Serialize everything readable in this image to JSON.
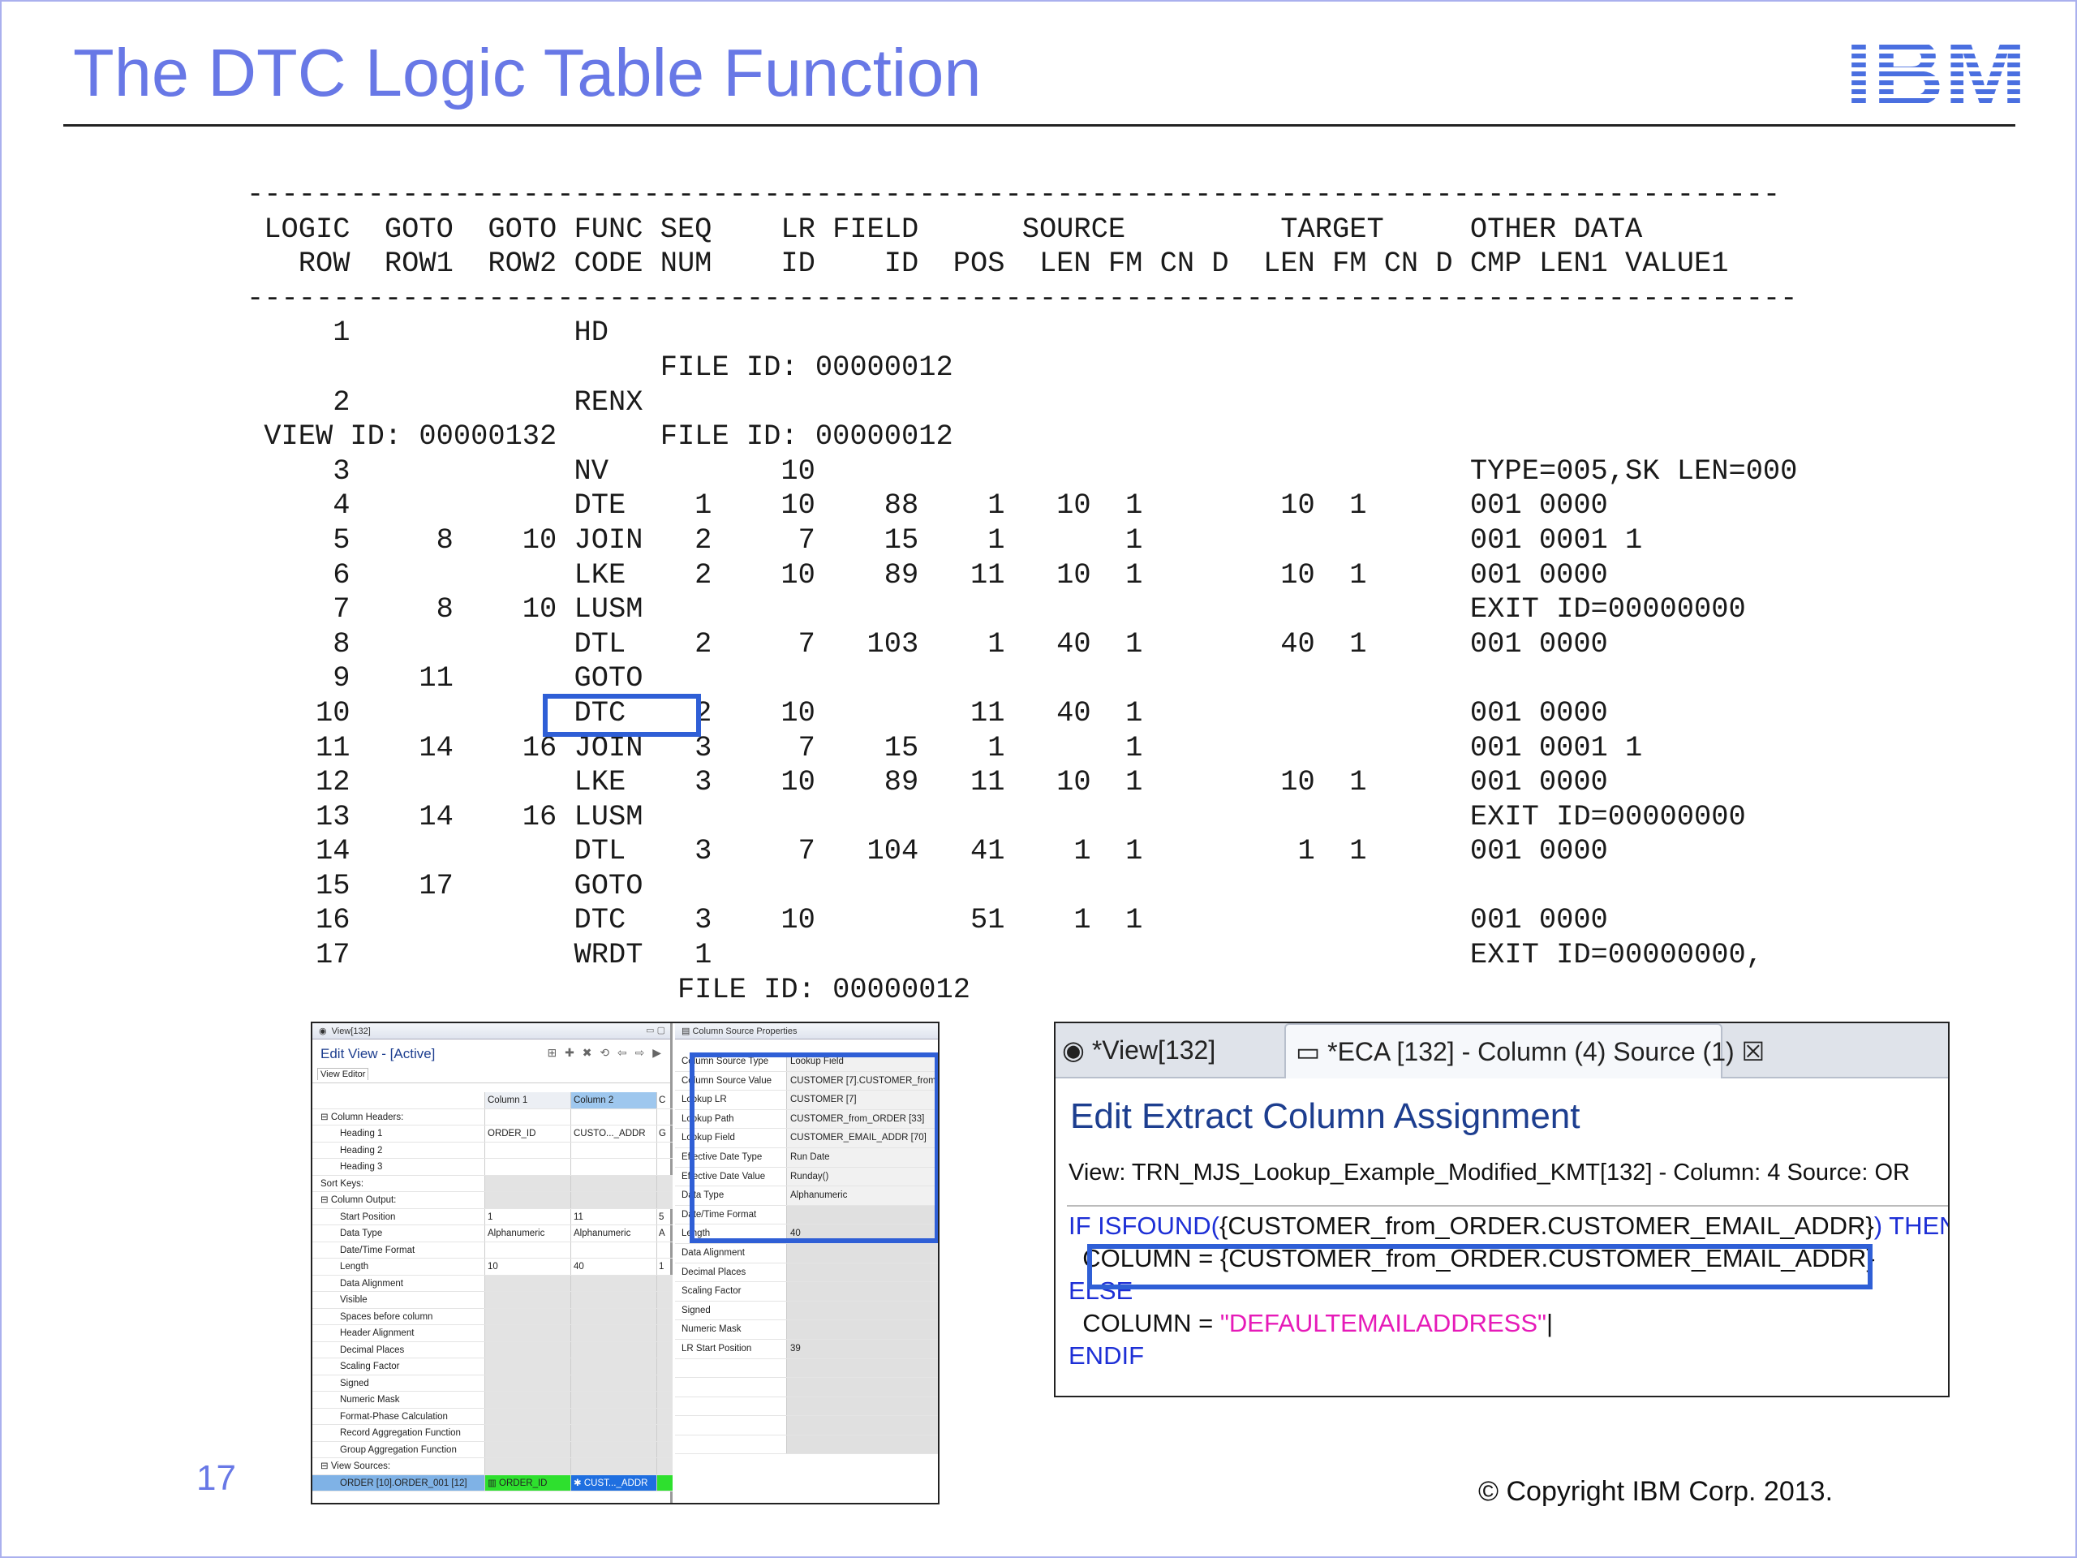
{
  "slide": {
    "title": "The DTC Logic Table Function",
    "logo_text": "IBM",
    "page_number": "17",
    "copyright": "© Copyright IBM Corp. 2013."
  },
  "logic_table": {
    "lines": [
      "-----------------------------------------------------------------------------------------",
      " LOGIC  GOTO  GOTO FUNC SEQ    LR FIELD      SOURCE         TARGET     OTHER DATA",
      "   ROW  ROW1  ROW2 CODE NUM    ID    ID  POS  LEN FM CN D  LEN FM CN D CMP LEN1 VALUE1",
      "------------------------------------------------------------------------------------------",
      "     1             HD",
      "                        FILE ID: 00000012",
      "     2             RENX",
      " VIEW ID: 00000132      FILE ID: 00000012",
      "     3             NV          10                                      TYPE=005,SK LEN=000",
      "     4             DTE    1    10    88    1   10  1        10  1      001 0000",
      "     5     8    10 JOIN   2     7    15    1       1                   001 0001 1",
      "     6             LKE    2    10    89   11   10  1        10  1      001 0000",
      "     7     8    10 LUSM                                                EXIT ID=00000000",
      "     8             DTL    2     7   103    1   40  1        40  1      001 0000",
      "     9    11       GOTO",
      "    10             DTC    2    10         11   40  1                   001 0000",
      "    11    14    16 JOIN   3     7    15    1       1                   001 0001 1",
      "    12             LKE    3    10    89   11   10  1        10  1      001 0000",
      "    13    14    16 LUSM                                                EXIT ID=00000000",
      "    14             DTL    3     7   104   41    1  1         1  1      001 0000",
      "    15    17       GOTO",
      "    16             DTC    3    10         51    1  1                   001 0000",
      "    17             WRDT   1                                            EXIT ID=00000000,",
      "                         FILE ID: 00000012"
    ]
  },
  "edit_view": {
    "tab": "View[132]",
    "title": "Edit View - [Active]",
    "tool_icons": "⊞ ✚ ✖ ⟲ ⇦ ⇨ ▶",
    "subtab": "View Editor",
    "rows": [
      {
        "label": "",
        "c1": "Column 1",
        "c2": "Column 2",
        "c3": "C",
        "style": "hdr"
      },
      {
        "label": "⊟  Column Headers:",
        "c1": "",
        "c2": "",
        "c3": "",
        "style": "sec"
      },
      {
        "label": "Heading 1",
        "c1": "ORDER_ID",
        "c2": "CUSTO..._ADDR",
        "c3": "G",
        "style": ""
      },
      {
        "label": "Heading 2",
        "c1": "",
        "c2": "",
        "c3": "",
        "style": ""
      },
      {
        "label": "Heading 3",
        "c1": "",
        "c2": "",
        "c3": "",
        "style": ""
      },
      {
        "label": "Sort Keys:",
        "c1": "",
        "c2": "",
        "c3": "",
        "style": "sec gray"
      },
      {
        "label": "⊟  Column Output:",
        "c1": "",
        "c2": "",
        "c3": "",
        "style": "sec gray"
      },
      {
        "label": "Start Position",
        "c1": "1",
        "c2": "11",
        "c3": "5",
        "style": ""
      },
      {
        "label": "Data Type",
        "c1": "Alphanumeric",
        "c2": "Alphanumeric",
        "c3": "A",
        "style": ""
      },
      {
        "label": "Date/Time Format",
        "c1": "",
        "c2": "",
        "c3": "",
        "style": ""
      },
      {
        "label": "Length",
        "c1": "10",
        "c2": "40",
        "c3": "1",
        "style": ""
      },
      {
        "label": "Data Alignment",
        "c1": "",
        "c2": "",
        "c3": "",
        "style": "gray"
      },
      {
        "label": "Visible",
        "c1": "",
        "c2": "",
        "c3": "",
        "style": "gray"
      },
      {
        "label": "Spaces before column",
        "c1": "",
        "c2": "",
        "c3": "",
        "style": "gray"
      },
      {
        "label": "Header Alignment",
        "c1": "",
        "c2": "",
        "c3": "",
        "style": "gray"
      },
      {
        "label": "Decimal Places",
        "c1": "",
        "c2": "",
        "c3": "",
        "style": "gray"
      },
      {
        "label": "Scaling Factor",
        "c1": "",
        "c2": "",
        "c3": "",
        "style": "gray"
      },
      {
        "label": "Signed",
        "c1": "",
        "c2": "",
        "c3": "",
        "style": "gray"
      },
      {
        "label": "Numeric Mask",
        "c1": "",
        "c2": "",
        "c3": "",
        "style": "gray"
      },
      {
        "label": "Format-Phase Calculation",
        "c1": "",
        "c2": "",
        "c3": "",
        "style": "gray"
      },
      {
        "label": "Record Aggregation Function",
        "c1": "",
        "c2": "",
        "c3": "",
        "style": "gray"
      },
      {
        "label": "Group Aggregation Function",
        "c1": "",
        "c2": "",
        "c3": "",
        "style": "gray"
      },
      {
        "label": "⊟  View Sources:",
        "c1": "",
        "c2": "",
        "c3": "",
        "style": "sec gray"
      },
      {
        "label": "ORDER [10].ORDER_001 [12]",
        "c1": "▥ ORDER_ID",
        "c2": "✱ CUST..._ADDR",
        "c3": "",
        "style": "src"
      }
    ]
  },
  "column_source": {
    "tab": "Column Source Properties",
    "rows": [
      {
        "k": "Column Source Type",
        "v": "Lookup Field"
      },
      {
        "k": "Column Source Value",
        "v": "CUSTOMER [7].CUSTOMER_from"
      },
      {
        "k": "Lookup LR",
        "v": "CUSTOMER [7]"
      },
      {
        "k": "Lookup Path",
        "v": "CUSTOMER_from_ORDER [33]"
      },
      {
        "k": "Lookup Field",
        "v": "CUSTOMER_EMAIL_ADDR [70]"
      },
      {
        "k": "Effective Date Type",
        "v": "Run Date"
      },
      {
        "k": "Effective Date Value",
        "v": "Runday()"
      },
      {
        "k": "Data Type",
        "v": "Alphanumeric"
      },
      {
        "k": "Date/Time Format",
        "v": ""
      },
      {
        "k": "Length",
        "v": "40"
      },
      {
        "k": "Data Alignment",
        "v": ""
      },
      {
        "k": "Decimal Places",
        "v": ""
      },
      {
        "k": "Scaling Factor",
        "v": ""
      },
      {
        "k": "Signed",
        "v": ""
      },
      {
        "k": "Numeric Mask",
        "v": ""
      },
      {
        "k": "LR Start Position",
        "v": "39"
      },
      {
        "k": "",
        "v": ""
      },
      {
        "k": "",
        "v": ""
      },
      {
        "k": "",
        "v": ""
      },
      {
        "k": "",
        "v": ""
      },
      {
        "k": "",
        "v": ""
      }
    ]
  },
  "eca": {
    "tab1": "*View[132]",
    "tab2": "*ECA [132] - Column (4) Source (1)",
    "title": "Edit Extract Column Assignment",
    "view_line": "View: TRN_MJS_Lookup_Example_Modified_KMT[132] - Column: 4 Source: OR",
    "code": {
      "l1_kw": "IF ISFOUND(",
      "l1_tx": "{CUSTOMER_from_ORDER.CUSTOMER_EMAIL_ADDR}",
      "l1_kw2": ") THEN",
      "l2_tx": "  COLUMN = {CUSTOMER_from_ORDER.CUSTOMER_EMAIL_ADDR}",
      "l3_kw": "ELSE",
      "l4_tx": "  COLUMN = ",
      "l4_str": "\"DEFAULTEMAILADDRESS\"",
      "l5_kw": "ENDIF"
    }
  },
  "colors": {
    "title": "#6878e6",
    "highlight_box": "#2f5fd6",
    "keyword": "#1d2fd6",
    "string": "#e61ab8"
  }
}
